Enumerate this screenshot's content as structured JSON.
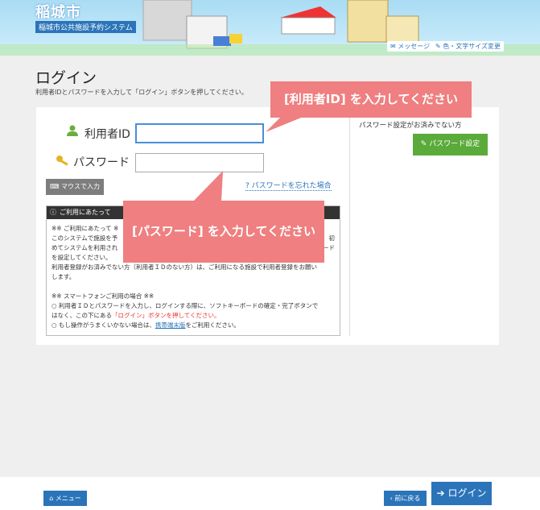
{
  "header": {
    "city_name": "稲城市",
    "system_name": "稲城市公共施設予約システム",
    "message_label": "メッセージ",
    "color_label": "色・文字サイズ変更"
  },
  "page": {
    "title": "ログイン",
    "description": "利用者IDとパスワードを入力して「ログイン」ボタンを押してください。"
  },
  "form": {
    "user_id_label": "利用者ID",
    "user_id_value": "",
    "password_label": "パスワード",
    "password_value": "",
    "mouse_input_label": "マウスで入力",
    "forgot_password_label": "パスワードを忘れた場合"
  },
  "notice": {
    "title": "ご利用にあたって",
    "line1": "※※ ご利用にあたって ※",
    "line2": "このシステムで施設を予",
    "line2_end": "初",
    "line3": "めてシステムを利用され",
    "line3_end": "ード",
    "line4": "を設定してください。",
    "line5": "利用者登録がお済みでない方（利用者ＩＤのない方）は、ご利用になる施設で利用者登録をお願い",
    "line6": "します。",
    "line7": "※※ スマートフォンご利用の場合 ※※",
    "line8": "○ 利用者ＩＤとパスワードを入力し、ログインする際に、ソフトキーボードの確定・完了ボタンで",
    "line9_pre": "はなく、この下にある",
    "line9_red": "「ログイン」ボタンを押してください。",
    "line10_pre": "○ もし操作がうまくいかない場合は、",
    "line10_link": "携帯端末版",
    "line10_post": "をご利用ください。"
  },
  "register": {
    "note": "パスワード設定がお済みでない方",
    "button_label": "パスワード設定"
  },
  "tips": {
    "user_id_tip": "[利用者ID] を入力してください",
    "password_tip": "[パスワード] を入力してください"
  },
  "footer": {
    "menu_label": "メニュー",
    "back_label": "前に戻る",
    "login_label": "ログイン"
  },
  "colors": {
    "primary": "#2b74b9",
    "tip": "#ef7f80",
    "register": "#5aab3a"
  }
}
